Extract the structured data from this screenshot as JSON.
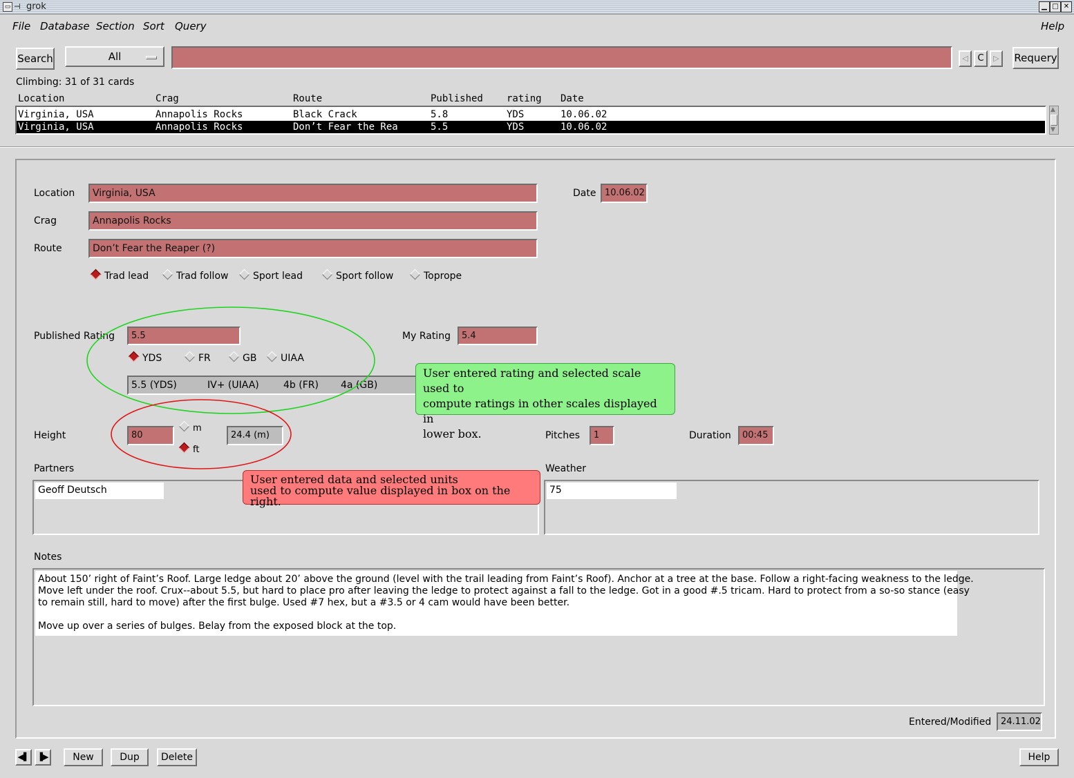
{
  "window": {
    "title": "grok"
  },
  "menu": {
    "file": "File",
    "database": "Database",
    "section": "Section",
    "sort": "Sort",
    "query": "Query",
    "help": "Help"
  },
  "toolbar": {
    "search_label": "Search",
    "scope_value": "All",
    "query_value": "",
    "nav_c": "C",
    "requery_label": "Requery"
  },
  "status": {
    "text": "Climbing: 31 of 31 cards"
  },
  "list": {
    "headers": [
      "Location",
      "Crag",
      "Route",
      "Published",
      "rating",
      "Date"
    ],
    "rows": [
      [
        "Virginia, USA",
        "Annapolis Rocks",
        "Black Crack",
        "5.8",
        "YDS",
        "10.06.02"
      ],
      [
        "Virginia, USA",
        "Annapolis Rocks",
        "Don’t Fear the Rea",
        "5.5",
        "YDS",
        "10.06.02"
      ]
    ]
  },
  "form": {
    "location_label": "Location",
    "location_value": "Virginia, USA",
    "crag_label": "Crag",
    "crag_value": "Annapolis Rocks",
    "route_label": "Route",
    "route_value": "Don’t Fear the Reaper (?)",
    "date_label": "Date",
    "date_value": "10.06.02",
    "style_options": [
      "Trad lead",
      "Trad follow",
      "Sport lead",
      "Sport follow",
      "Toprope"
    ],
    "style_selected": "Trad lead",
    "published_rating_label": "Published Rating",
    "published_rating_value": "5.5",
    "my_rating_label": "My Rating",
    "my_rating_value": "5.4",
    "scale_options": [
      "YDS",
      "FR",
      "GB",
      "UIAA"
    ],
    "scale_selected": "YDS",
    "converted": [
      "5.5 (YDS)",
      "IV+ (UIAA)",
      "4b (FR)",
      "4a (GB)"
    ],
    "height_label": "Height",
    "height_value": "80",
    "unit_options": [
      "m",
      "ft"
    ],
    "unit_selected": "ft",
    "height_converted": "24.4 (m)",
    "pitches_label": "Pitches",
    "pitches_value": "1",
    "duration_label": "Duration",
    "duration_value": "00:45",
    "partners_label": "Partners",
    "partners_value": "Geoff Deutsch",
    "weather_label": "Weather",
    "weather_value": "75",
    "notes_label": "Notes",
    "notes_lines": [
      "About 150’ right of Faint’s Roof. Large ledge about 20’ above the ground (level with the trail leading from Faint’s Roof). Anchor at a tree at the base. Follow a right-facing weakness to the ledge.",
      "Move left under the roof. Crux--about 5.5, but hard to place pro after leaving the ledge to protect against a fall to the ledge. Got in a good #.5 tricam. Hard to protect from a so-so stance (easy",
      "to remain still, hard to move) after the first bulge. Used #7 hex, but a #3.5 or 4 cam would have been better.",
      "",
      "Move up over a series of bulges. Belay from the exposed block at the top."
    ],
    "entered_label": "Entered/Modified",
    "entered_value": "24.11.02"
  },
  "annotations": {
    "rating_callout": [
      "User entered rating and selected scale used to",
      "compute ratings in other scales displayed in",
      "lower box."
    ],
    "height_callout": [
      "User entered data and selected units",
      "used to compute value displayed in box on the right."
    ],
    "green": "#1fd41f",
    "red": "#e01515",
    "green_fill": "#8ef28a",
    "red_fill": "#ff7b7b"
  },
  "footer": {
    "new_label": "New",
    "dup_label": "Dup",
    "delete_label": "Delete",
    "help_label": "Help"
  }
}
